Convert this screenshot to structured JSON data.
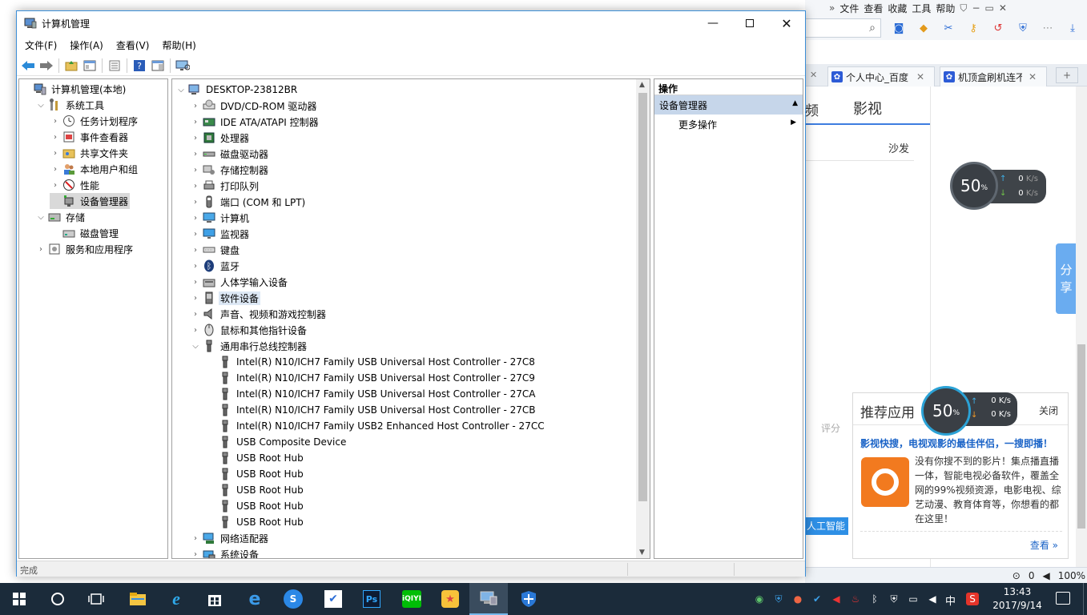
{
  "browser": {
    "menu": [
      "文件",
      "查看",
      "收藏",
      "工具",
      "帮助"
    ],
    "tabs": [
      {
        "label": "个人中心_百度"
      },
      {
        "label": "机顶盒刷机连不"
      }
    ],
    "page_nav_partial": "频",
    "page_nav_video": "影视",
    "sofa": "沙发",
    "rating_partial": "评分",
    "ai_banner": "人工智能",
    "share_label": "分享",
    "status_partial": [
      "0",
      "100%"
    ]
  },
  "speed_widget_top": {
    "percent": "50",
    "percent_unit": "%",
    "up": "0",
    "down": "0",
    "unit": "K/s"
  },
  "speed_widget_bottom": {
    "percent": "50",
    "percent_unit": "%",
    "up": "0",
    "down": "0",
    "unit": "K/s"
  },
  "recommend": {
    "title": "推荐应用",
    "close": "关闭",
    "headline": "影视快搜，电视观影的最佳伴侣，一搜即播！",
    "description": "没有你搜不到的影片！集点播直播一体，智能电视必备软件，覆盖全网的99%视频资源，电影电视、综艺动漫、教育体育等，你想看的都在这里！",
    "more": "查看 »"
  },
  "window": {
    "title": "计算机管理",
    "menu": [
      "文件(F)",
      "操作(A)",
      "查看(V)",
      "帮助(H)"
    ],
    "status_text": "完成"
  },
  "left_tree": [
    {
      "label": "计算机管理(本地)",
      "level": 0,
      "expander": "",
      "icon": "computer-management-icon"
    },
    {
      "label": "系统工具",
      "level": 1,
      "expander": "open",
      "icon": "system-tools-icon"
    },
    {
      "label": "任务计划程序",
      "level": 2,
      "expander": "closed",
      "icon": "clock-icon"
    },
    {
      "label": "事件查看器",
      "level": 2,
      "expander": "closed",
      "icon": "event-viewer-icon"
    },
    {
      "label": "共享文件夹",
      "level": 2,
      "expander": "closed",
      "icon": "shared-folder-icon"
    },
    {
      "label": "本地用户和组",
      "level": 2,
      "expander": "closed",
      "icon": "users-icon"
    },
    {
      "label": "性能",
      "level": 2,
      "expander": "closed",
      "icon": "performance-icon"
    },
    {
      "label": "设备管理器",
      "level": 2,
      "expander": "",
      "icon": "device-manager-icon",
      "selected": true
    },
    {
      "label": "存储",
      "level": 1,
      "expander": "open",
      "icon": "storage-icon"
    },
    {
      "label": "磁盘管理",
      "level": 2,
      "expander": "",
      "icon": "disk-management-icon"
    },
    {
      "label": "服务和应用程序",
      "level": 1,
      "expander": "closed",
      "icon": "services-icon"
    }
  ],
  "device_tree": {
    "root": "DESKTOP-23812BR",
    "items": [
      {
        "label": "DVD/CD-ROM 驱动器",
        "level": 1,
        "expander": "closed",
        "icon": "dvd-drive-icon"
      },
      {
        "label": "IDE ATA/ATAPI 控制器",
        "level": 1,
        "expander": "closed",
        "icon": "ide-controller-icon"
      },
      {
        "label": "处理器",
        "level": 1,
        "expander": "closed",
        "icon": "processor-icon"
      },
      {
        "label": "磁盘驱动器",
        "level": 1,
        "expander": "closed",
        "icon": "disk-drive-icon"
      },
      {
        "label": "存储控制器",
        "level": 1,
        "expander": "closed",
        "icon": "storage-controller-icon"
      },
      {
        "label": "打印队列",
        "level": 1,
        "expander": "closed",
        "icon": "printer-icon"
      },
      {
        "label": "端口 (COM 和 LPT)",
        "level": 1,
        "expander": "closed",
        "icon": "port-icon"
      },
      {
        "label": "计算机",
        "level": 1,
        "expander": "closed",
        "icon": "computer-icon"
      },
      {
        "label": "监视器",
        "level": 1,
        "expander": "closed",
        "icon": "monitor-icon"
      },
      {
        "label": "键盘",
        "level": 1,
        "expander": "closed",
        "icon": "keyboard-icon"
      },
      {
        "label": "蓝牙",
        "level": 1,
        "expander": "closed",
        "icon": "bluetooth-icon"
      },
      {
        "label": "人体学输入设备",
        "level": 1,
        "expander": "closed",
        "icon": "hid-icon"
      },
      {
        "label": "软件设备",
        "level": 1,
        "expander": "closed",
        "icon": "software-device-icon",
        "selected": true
      },
      {
        "label": "声音、视频和游戏控制器",
        "level": 1,
        "expander": "closed",
        "icon": "speaker-icon"
      },
      {
        "label": "鼠标和其他指针设备",
        "level": 1,
        "expander": "closed",
        "icon": "mouse-icon"
      },
      {
        "label": "通用串行总线控制器",
        "level": 1,
        "expander": "open",
        "icon": "usb-icon"
      },
      {
        "label": "Intel(R) N10/ICH7 Family USB Universal Host Controller - 27C8",
        "level": 2,
        "expander": "",
        "icon": "usb-icon"
      },
      {
        "label": "Intel(R) N10/ICH7 Family USB Universal Host Controller - 27C9",
        "level": 2,
        "expander": "",
        "icon": "usb-icon"
      },
      {
        "label": "Intel(R) N10/ICH7 Family USB Universal Host Controller - 27CA",
        "level": 2,
        "expander": "",
        "icon": "usb-icon"
      },
      {
        "label": "Intel(R) N10/ICH7 Family USB Universal Host Controller - 27CB",
        "level": 2,
        "expander": "",
        "icon": "usb-icon"
      },
      {
        "label": "Intel(R) N10/ICH7 Family USB2 Enhanced Host Controller - 27CC",
        "level": 2,
        "expander": "",
        "icon": "usb-icon"
      },
      {
        "label": "USB Composite Device",
        "level": 2,
        "expander": "",
        "icon": "usb-icon"
      },
      {
        "label": "USB Root Hub",
        "level": 2,
        "expander": "",
        "icon": "usb-icon"
      },
      {
        "label": "USB Root Hub",
        "level": 2,
        "expander": "",
        "icon": "usb-icon"
      },
      {
        "label": "USB Root Hub",
        "level": 2,
        "expander": "",
        "icon": "usb-icon"
      },
      {
        "label": "USB Root Hub",
        "level": 2,
        "expander": "",
        "icon": "usb-icon"
      },
      {
        "label": "USB Root Hub",
        "level": 2,
        "expander": "",
        "icon": "usb-icon"
      },
      {
        "label": "网络适配器",
        "level": 1,
        "expander": "closed",
        "icon": "network-adapter-icon"
      },
      {
        "label": "系统设备",
        "level": 1,
        "expander": "closed",
        "icon": "system-device-icon"
      }
    ]
  },
  "actions": {
    "header": "操作",
    "section": "设备管理器",
    "more": "更多操作"
  },
  "taskbar": {
    "apps": [
      "start-icon",
      "cortana-icon",
      "task-view-icon",
      "file-explorer-icon",
      "ie-icon",
      "store-icon",
      "edge-icon",
      "sogou-browser-icon",
      "feishu-icon",
      "photoshop-icon",
      "iqiyi-icon",
      "app-icon",
      "computer-management-icon",
      "security-icon"
    ],
    "ime": "中",
    "time": "13:43",
    "date": "2017/9/14"
  },
  "colors": {
    "accent": "#3c8fd8",
    "selection": "#dde8f5",
    "taskbar": "#1b2b3a",
    "actions_section": "#c6d6ea"
  }
}
